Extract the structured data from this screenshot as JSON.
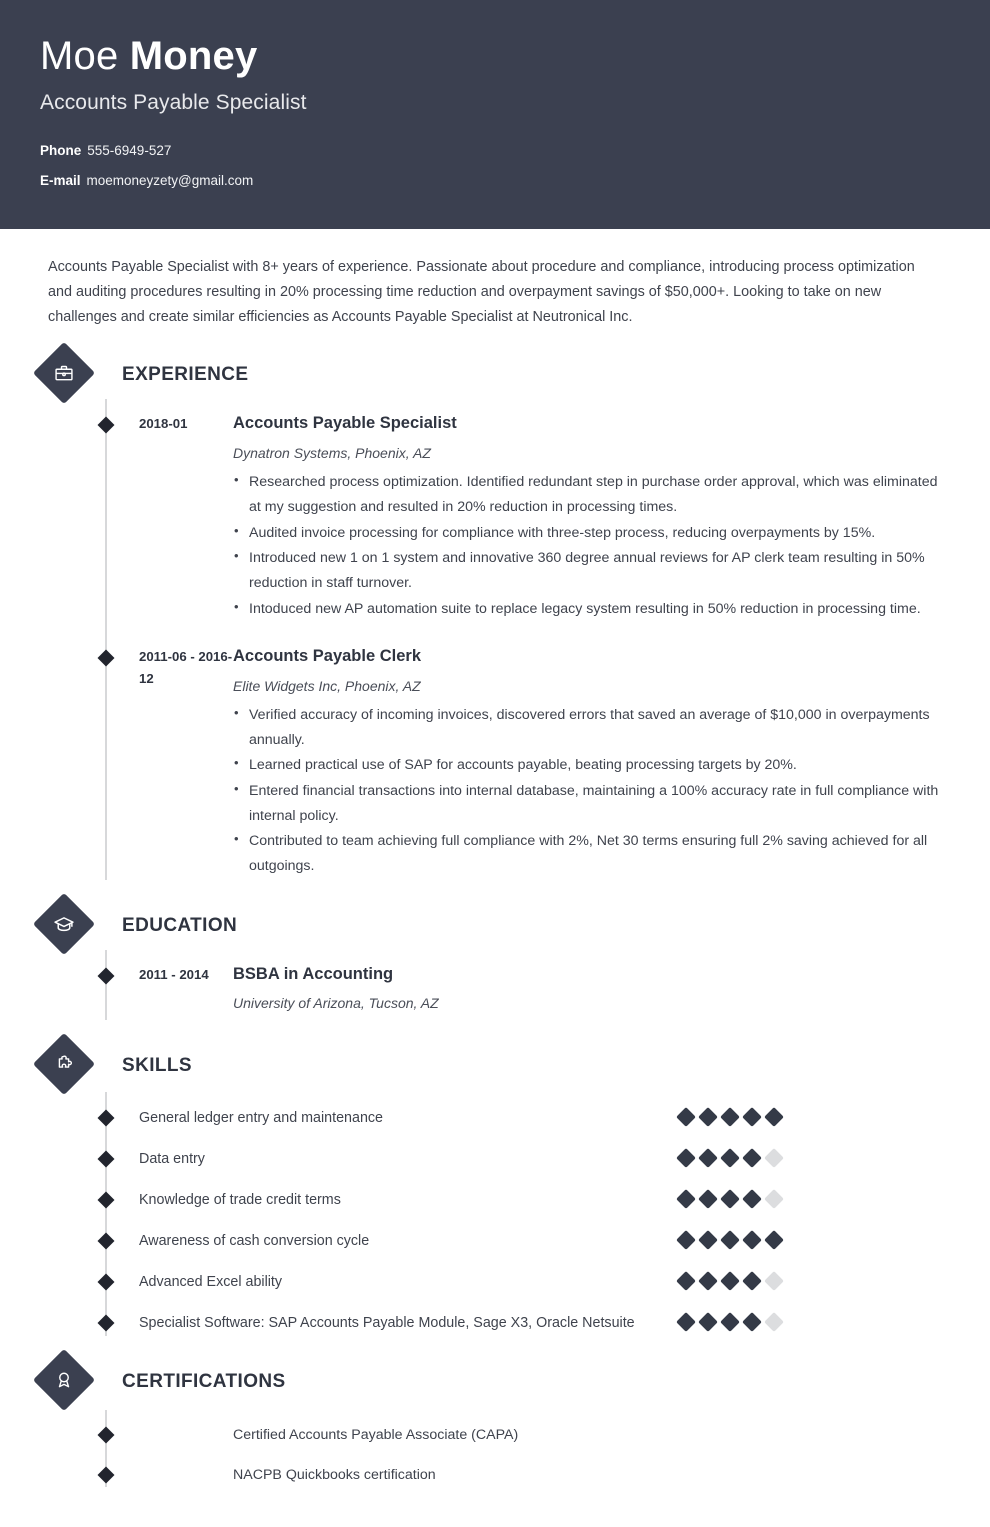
{
  "header": {
    "first_name": "Moe ",
    "last_name": "Money",
    "job_title": "Accounts Payable Specialist",
    "contacts": [
      {
        "label": "Phone",
        "value": "555-6949-527"
      },
      {
        "label": "E-mail",
        "value": "moemoneyzety@gmail.com"
      }
    ],
    "background_color": "#3b4050"
  },
  "summary": "Accounts Payable Specialist with 8+ years of experience. Passionate about procedure and compliance, introducing process optimization and auditing procedures resulting in 20% processing time reduction and overpayment savings of $50,000+. Looking to take on new challenges and create similar efficiencies as Accounts Payable Specialist at Neutronical Inc.",
  "sections": {
    "experience": {
      "title": "EXPERIENCE",
      "icon": "briefcase-icon",
      "entries": [
        {
          "date": "2018-01",
          "title": "Accounts Payable Specialist",
          "subtitle": "Dynatron Systems, Phoenix, AZ",
          "bullets": [
            "Researched process optimization. Identified redundant step in purchase order approval, which was eliminated at my suggestion and resulted in 20% reduction in processing times.",
            "Audited invoice processing for compliance with three-step process, reducing overpayments by 15%.",
            "Introduced new 1 on 1 system and innovative 360 degree annual reviews for AP clerk team resulting in 50% reduction in staff turnover.",
            "Intoduced new AP automation suite to replace legacy system resulting in 50% reduction in processing time."
          ]
        },
        {
          "date": "2011-06 - 2016-12",
          "title": "Accounts Payable Clerk",
          "subtitle": "Elite Widgets Inc, Phoenix, AZ",
          "bullets": [
            "Verified accuracy of incoming invoices, discovered errors that saved an average of $10,000 in overpayments annually.",
            "Learned practical use of SAP for accounts payable, beating processing targets by 20%.",
            "Entered financial transactions into internal database, maintaining a 100% accuracy rate in full compliance with internal policy.",
            "Contributed to team achieving full compliance with 2%, Net 30 terms ensuring full 2% saving achieved for all outgoings."
          ]
        }
      ]
    },
    "education": {
      "title": "EDUCATION",
      "icon": "graduation-cap-icon",
      "entries": [
        {
          "date": "2011 - 2014",
          "title": "BSBA in Accounting",
          "subtitle": "University of Arizona, Tucson, AZ"
        }
      ]
    },
    "skills": {
      "title": "SKILLS",
      "icon": "puzzle-piece-icon",
      "max_rating": 5,
      "items": [
        {
          "name": "General ledger entry and maintenance",
          "rating": 5
        },
        {
          "name": "Data entry",
          "rating": 4
        },
        {
          "name": "Knowledge of trade credit terms",
          "rating": 4
        },
        {
          "name": "Awareness of cash conversion cycle",
          "rating": 5
        },
        {
          "name": "Advanced Excel ability",
          "rating": 4
        },
        {
          "name": "Specialist Software: SAP Accounts Payable Module, Sage X3, Oracle Netsuite",
          "rating": 4
        }
      ]
    },
    "certifications": {
      "title": "CERTIFICATIONS",
      "icon": "award-ribbon-icon",
      "items": [
        "Certified Accounts Payable Associate (CAPA)",
        "NACPB Quickbooks certification"
      ]
    }
  },
  "colors": {
    "dark": "#3b4050",
    "text": "#3f434d",
    "heading": "#2f3440",
    "marker": "#22252e",
    "line": "#d7d8da",
    "dot_on": "#343a47",
    "dot_off": "#dcdddf"
  }
}
